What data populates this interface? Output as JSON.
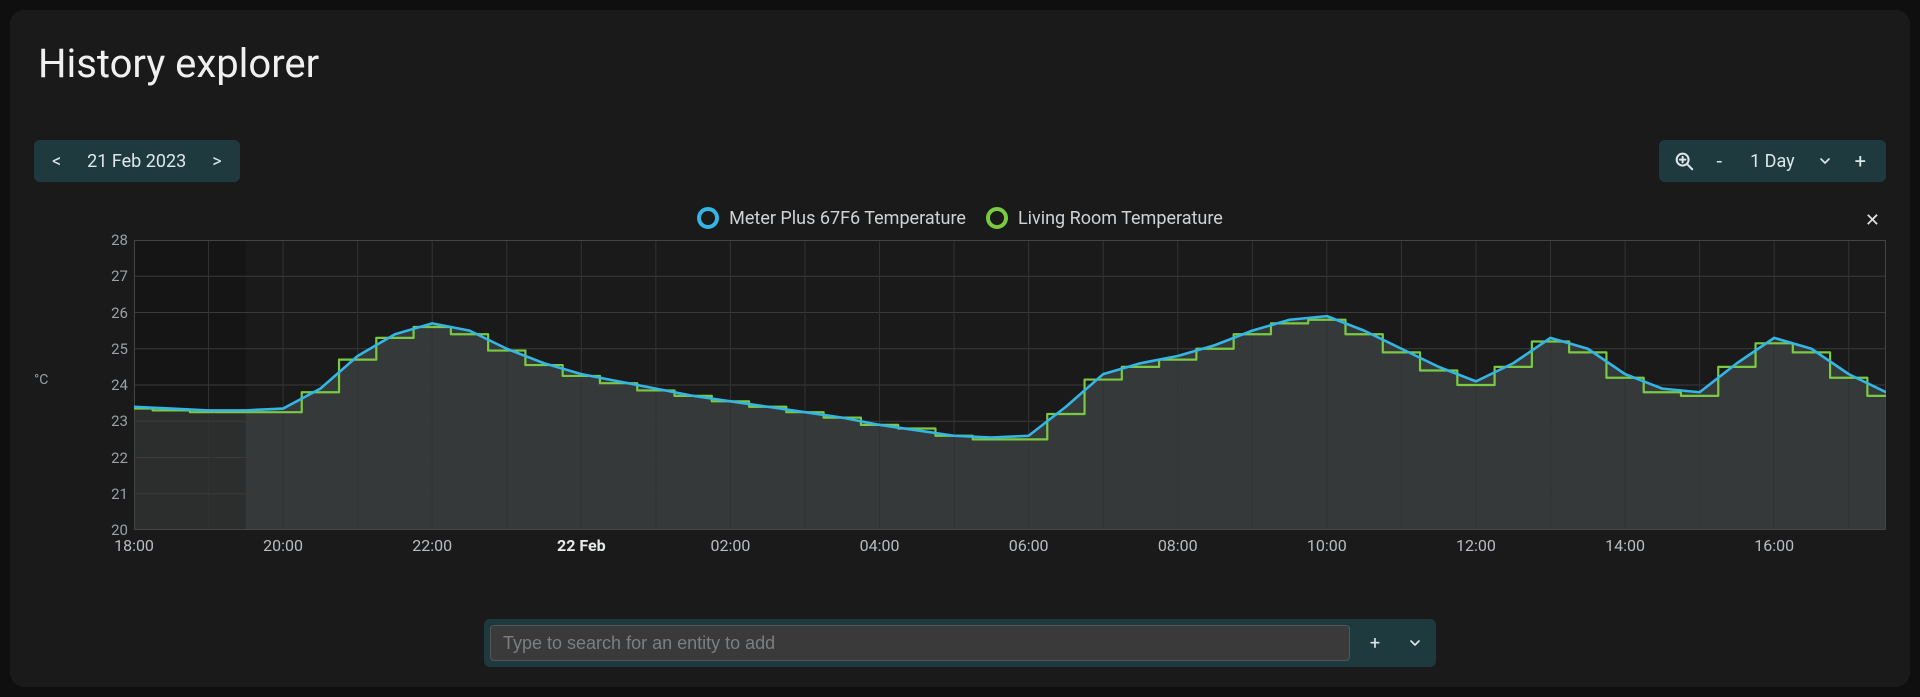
{
  "title": "History explorer",
  "date_nav": {
    "prev": "<",
    "label": "21 Feb 2023",
    "next": ">"
  },
  "range_nav": {
    "minus": "-",
    "label": "1 Day",
    "plus": "+"
  },
  "chart_close": "✕",
  "search": {
    "placeholder": "Type to search for an entity to add",
    "add": "+",
    "expand": "⌄"
  },
  "chart_data": {
    "type": "line",
    "ylabel": "°C",
    "ylim": [
      20,
      28
    ],
    "yticks": [
      20,
      21,
      22,
      23,
      24,
      25,
      26,
      27,
      28
    ],
    "x": [
      "18:00",
      "18:30",
      "19:00",
      "19:30",
      "20:00",
      "20:30",
      "21:00",
      "21:30",
      "22:00",
      "22:30",
      "23:00",
      "23:30",
      "00:00",
      "00:30",
      "01:00",
      "01:30",
      "02:00",
      "02:30",
      "03:00",
      "03:30",
      "04:00",
      "04:30",
      "05:00",
      "05:30",
      "06:00",
      "06:30",
      "07:00",
      "07:30",
      "08:00",
      "08:30",
      "09:00",
      "09:30",
      "10:00",
      "10:30",
      "11:00",
      "11:30",
      "12:00",
      "12:30",
      "13:00",
      "13:30",
      "14:00",
      "14:30",
      "15:00",
      "15:30",
      "16:00",
      "16:30",
      "17:00",
      "17:30"
    ],
    "xticks": [
      "18:00",
      "20:00",
      "22:00",
      "22 Feb",
      "02:00",
      "04:00",
      "06:00",
      "08:00",
      "10:00",
      "12:00",
      "14:00",
      "16:00"
    ],
    "xtick_bold_index": 3,
    "series": [
      {
        "name": "Meter Plus 67F6 Temperature",
        "color": "#33b5e5",
        "values": [
          23.4,
          23.35,
          23.3,
          23.3,
          23.35,
          23.9,
          24.8,
          25.4,
          25.7,
          25.5,
          25.0,
          24.6,
          24.3,
          24.1,
          23.9,
          23.7,
          23.55,
          23.4,
          23.25,
          23.1,
          22.9,
          22.75,
          22.6,
          22.55,
          22.6,
          23.4,
          24.3,
          24.6,
          24.8,
          25.1,
          25.5,
          25.8,
          25.9,
          25.5,
          25.0,
          24.5,
          24.1,
          24.6,
          25.3,
          25.0,
          24.3,
          23.9,
          23.8,
          24.6,
          25.3,
          25.0,
          24.3,
          23.8
        ]
      },
      {
        "name": "Living Room Temperature",
        "color": "#7ac943",
        "values": [
          23.35,
          23.3,
          23.25,
          23.25,
          23.25,
          23.8,
          24.7,
          25.3,
          25.6,
          25.4,
          24.95,
          24.55,
          24.25,
          24.05,
          23.85,
          23.7,
          23.55,
          23.4,
          23.25,
          23.1,
          22.9,
          22.8,
          22.6,
          22.5,
          22.5,
          23.2,
          24.15,
          24.5,
          24.7,
          25.0,
          25.4,
          25.7,
          25.8,
          25.4,
          24.9,
          24.4,
          24.0,
          24.5,
          25.2,
          24.9,
          24.2,
          23.8,
          23.7,
          24.5,
          25.15,
          24.9,
          24.2,
          23.7
        ]
      }
    ]
  }
}
